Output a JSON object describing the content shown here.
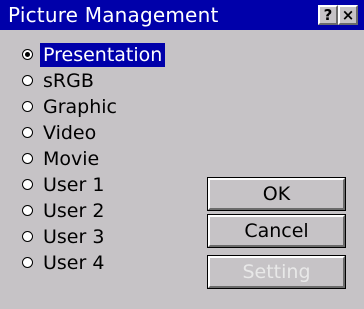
{
  "window": {
    "title": "Picture Management",
    "help_glyph": "?",
    "close_glyph": "×"
  },
  "options": [
    {
      "label": "Presentation",
      "selected": true
    },
    {
      "label": "sRGB",
      "selected": false
    },
    {
      "label": "Graphic",
      "selected": false
    },
    {
      "label": "Video",
      "selected": false
    },
    {
      "label": "Movie",
      "selected": false
    },
    {
      "label": "User 1",
      "selected": false
    },
    {
      "label": "User 2",
      "selected": false
    },
    {
      "label": "User 3",
      "selected": false
    },
    {
      "label": "User 4",
      "selected": false
    }
  ],
  "buttons": {
    "ok": "OK",
    "cancel": "Cancel",
    "setting": "Setting"
  },
  "colors": {
    "titlebar": "#0000aa",
    "face": "#c6c3c6",
    "selection": "#0000aa"
  }
}
